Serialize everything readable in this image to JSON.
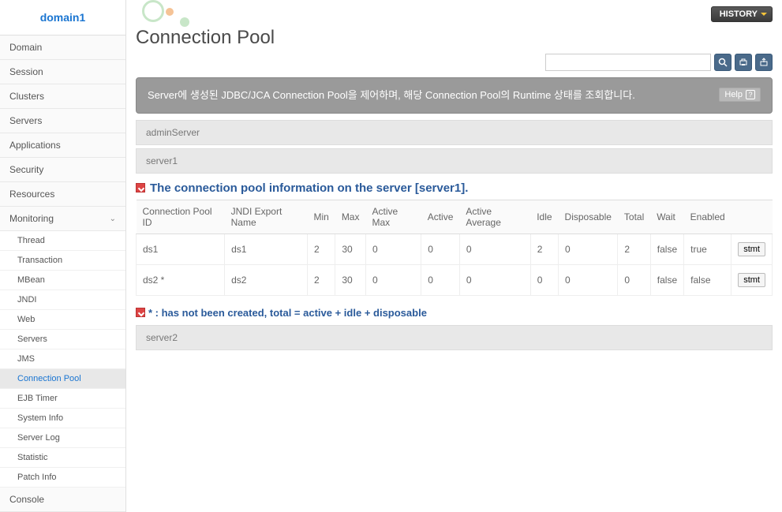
{
  "sidebar": {
    "domain": "domain1",
    "items": [
      {
        "label": "Domain"
      },
      {
        "label": "Session"
      },
      {
        "label": "Clusters"
      },
      {
        "label": "Servers"
      },
      {
        "label": "Applications"
      },
      {
        "label": "Security"
      },
      {
        "label": "Resources"
      },
      {
        "label": "Monitoring",
        "expanded": true
      }
    ],
    "subitems": [
      {
        "label": "Thread"
      },
      {
        "label": "Transaction"
      },
      {
        "label": "MBean"
      },
      {
        "label": "JNDI"
      },
      {
        "label": "Web"
      },
      {
        "label": "Servers"
      },
      {
        "label": "JMS"
      },
      {
        "label": "Connection Pool",
        "active": true
      },
      {
        "label": "EJB Timer"
      },
      {
        "label": "System Info"
      },
      {
        "label": "Server Log"
      },
      {
        "label": "Statistic"
      },
      {
        "label": "Patch Info"
      }
    ],
    "console": "Console"
  },
  "header": {
    "history": "HISTORY",
    "title": "Connection Pool",
    "search_placeholder": ""
  },
  "description": "Server에 생성된 JDBC/JCA Connection Pool을 제어하며, 해당 Connection Pool의 Runtime 상태를 조회합니다.",
  "help_label": "Help",
  "servers": {
    "admin": "adminServer",
    "server1": "server1",
    "server2": "server2"
  },
  "section": {
    "title": "The connection pool information on the server [server1]."
  },
  "table": {
    "headers": [
      "Connection Pool ID",
      "JNDI Export Name",
      "Min",
      "Max",
      "Active Max",
      "Active",
      "Active Average",
      "Idle",
      "Disposable",
      "Total",
      "Wait",
      "Enabled",
      ""
    ],
    "rows": [
      {
        "id": "ds1",
        "jndi": "ds1",
        "min": "2",
        "max": "30",
        "amax": "0",
        "active": "0",
        "aavg": "0",
        "idle": "2",
        "disp": "0",
        "total": "2",
        "wait": "false",
        "enabled": "true",
        "btn": "stmt"
      },
      {
        "id": "ds2 *",
        "jndi": "ds2",
        "min": "2",
        "max": "30",
        "amax": "0",
        "active": "0",
        "aavg": "0",
        "idle": "0",
        "disp": "0",
        "total": "0",
        "wait": "false",
        "enabled": "false",
        "btn": "stmt"
      }
    ]
  },
  "note": "* : has not been created, total = active + idle + disposable"
}
